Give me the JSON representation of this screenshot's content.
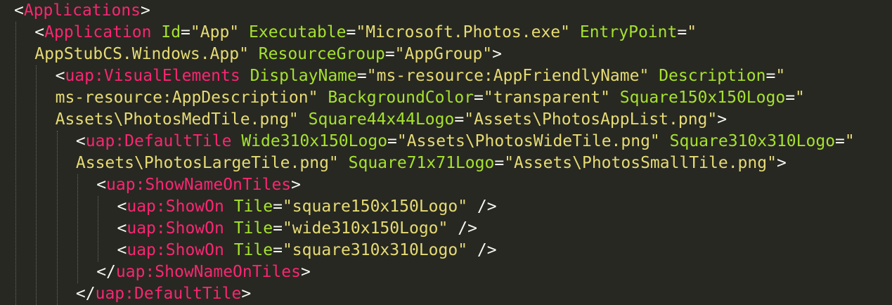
{
  "theme": {
    "background": "#272822",
    "tag": "#f92672",
    "attribute": "#a6e22e",
    "string": "#e6db74",
    "punctuation": "#f8f8f2"
  },
  "code_lines": [
    {
      "indent": 0,
      "tokens": [
        {
          "t": "punct",
          "v": "<"
        },
        {
          "t": "tag",
          "v": "Applications"
        },
        {
          "t": "punct",
          "v": ">"
        }
      ]
    },
    {
      "indent": 1,
      "tokens": [
        {
          "t": "punct",
          "v": "<"
        },
        {
          "t": "tag",
          "v": "Application"
        },
        {
          "t": "text",
          "v": " "
        },
        {
          "t": "attr",
          "v": "Id"
        },
        {
          "t": "punct",
          "v": "="
        },
        {
          "t": "str",
          "v": "\"App\""
        },
        {
          "t": "text",
          "v": " "
        },
        {
          "t": "attr",
          "v": "Executable"
        },
        {
          "t": "punct",
          "v": "="
        },
        {
          "t": "str",
          "v": "\"Microsoft.Photos.exe\""
        },
        {
          "t": "text",
          "v": " "
        },
        {
          "t": "attr",
          "v": "EntryPoint"
        },
        {
          "t": "punct",
          "v": "="
        },
        {
          "t": "str",
          "v": "\""
        }
      ]
    },
    {
      "indent": 1,
      "tokens": [
        {
          "t": "str",
          "v": "AppStubCS.Windows.App\""
        },
        {
          "t": "text",
          "v": " "
        },
        {
          "t": "attr",
          "v": "ResourceGroup"
        },
        {
          "t": "punct",
          "v": "="
        },
        {
          "t": "str",
          "v": "\"AppGroup\""
        },
        {
          "t": "punct",
          "v": ">"
        }
      ]
    },
    {
      "indent": 2,
      "tokens": [
        {
          "t": "punct",
          "v": "<"
        },
        {
          "t": "tag",
          "v": "uap:VisualElements"
        },
        {
          "t": "text",
          "v": " "
        },
        {
          "t": "attr",
          "v": "DisplayName"
        },
        {
          "t": "punct",
          "v": "="
        },
        {
          "t": "str",
          "v": "\"ms-resource:AppFriendlyName\""
        },
        {
          "t": "text",
          "v": " "
        },
        {
          "t": "attr",
          "v": "Description"
        },
        {
          "t": "punct",
          "v": "="
        },
        {
          "t": "str",
          "v": "\""
        }
      ]
    },
    {
      "indent": 2,
      "tokens": [
        {
          "t": "str",
          "v": "ms-resource:AppDescription\""
        },
        {
          "t": "text",
          "v": " "
        },
        {
          "t": "attr",
          "v": "BackgroundColor"
        },
        {
          "t": "punct",
          "v": "="
        },
        {
          "t": "str",
          "v": "\"transparent\""
        },
        {
          "t": "text",
          "v": " "
        },
        {
          "t": "attr",
          "v": "Square150x150Logo"
        },
        {
          "t": "punct",
          "v": "="
        },
        {
          "t": "str",
          "v": "\""
        }
      ]
    },
    {
      "indent": 2,
      "tokens": [
        {
          "t": "str",
          "v": "Assets\\PhotosMedTile.png\""
        },
        {
          "t": "text",
          "v": " "
        },
        {
          "t": "attr",
          "v": "Square44x44Logo"
        },
        {
          "t": "punct",
          "v": "="
        },
        {
          "t": "str",
          "v": "\"Assets\\PhotosAppList.png\""
        },
        {
          "t": "punct",
          "v": ">"
        }
      ]
    },
    {
      "indent": 3,
      "tokens": [
        {
          "t": "punct",
          "v": "<"
        },
        {
          "t": "tag",
          "v": "uap:DefaultTile"
        },
        {
          "t": "text",
          "v": " "
        },
        {
          "t": "attr",
          "v": "Wide310x150Logo"
        },
        {
          "t": "punct",
          "v": "="
        },
        {
          "t": "str",
          "v": "\"Assets\\PhotosWideTile.png\""
        },
        {
          "t": "text",
          "v": " "
        },
        {
          "t": "attr",
          "v": "Square310x310Logo"
        },
        {
          "t": "punct",
          "v": "="
        },
        {
          "t": "str",
          "v": "\""
        }
      ]
    },
    {
      "indent": 3,
      "tokens": [
        {
          "t": "str",
          "v": "Assets\\PhotosLargeTile.png\""
        },
        {
          "t": "text",
          "v": " "
        },
        {
          "t": "attr",
          "v": "Square71x71Logo"
        },
        {
          "t": "punct",
          "v": "="
        },
        {
          "t": "str",
          "v": "\"Assets\\PhotosSmallTile.png\""
        },
        {
          "t": "punct",
          "v": ">"
        }
      ]
    },
    {
      "indent": 4,
      "tokens": [
        {
          "t": "punct",
          "v": "<"
        },
        {
          "t": "tag",
          "v": "uap:ShowNameOnTiles"
        },
        {
          "t": "punct",
          "v": ">"
        }
      ]
    },
    {
      "indent": 5,
      "tokens": [
        {
          "t": "punct",
          "v": "<"
        },
        {
          "t": "tag",
          "v": "uap:ShowOn"
        },
        {
          "t": "text",
          "v": " "
        },
        {
          "t": "attr",
          "v": "Tile"
        },
        {
          "t": "punct",
          "v": "="
        },
        {
          "t": "str",
          "v": "\"square150x150Logo\""
        },
        {
          "t": "text",
          "v": " "
        },
        {
          "t": "punct",
          "v": "/>"
        }
      ]
    },
    {
      "indent": 5,
      "tokens": [
        {
          "t": "punct",
          "v": "<"
        },
        {
          "t": "tag",
          "v": "uap:ShowOn"
        },
        {
          "t": "text",
          "v": " "
        },
        {
          "t": "attr",
          "v": "Tile"
        },
        {
          "t": "punct",
          "v": "="
        },
        {
          "t": "str",
          "v": "\"wide310x150Logo\""
        },
        {
          "t": "text",
          "v": " "
        },
        {
          "t": "punct",
          "v": "/>"
        }
      ]
    },
    {
      "indent": 5,
      "tokens": [
        {
          "t": "punct",
          "v": "<"
        },
        {
          "t": "tag",
          "v": "uap:ShowOn"
        },
        {
          "t": "text",
          "v": " "
        },
        {
          "t": "attr",
          "v": "Tile"
        },
        {
          "t": "punct",
          "v": "="
        },
        {
          "t": "str",
          "v": "\"square310x310Logo\""
        },
        {
          "t": "text",
          "v": " "
        },
        {
          "t": "punct",
          "v": "/>"
        }
      ]
    },
    {
      "indent": 4,
      "tokens": [
        {
          "t": "punct",
          "v": "</"
        },
        {
          "t": "tag",
          "v": "uap:ShowNameOnTiles"
        },
        {
          "t": "punct",
          "v": ">"
        }
      ]
    },
    {
      "indent": 3,
      "tokens": [
        {
          "t": "punct",
          "v": "</"
        },
        {
          "t": "tag",
          "v": "uap:DefaultTile"
        },
        {
          "t": "punct",
          "v": ">"
        }
      ]
    }
  ]
}
